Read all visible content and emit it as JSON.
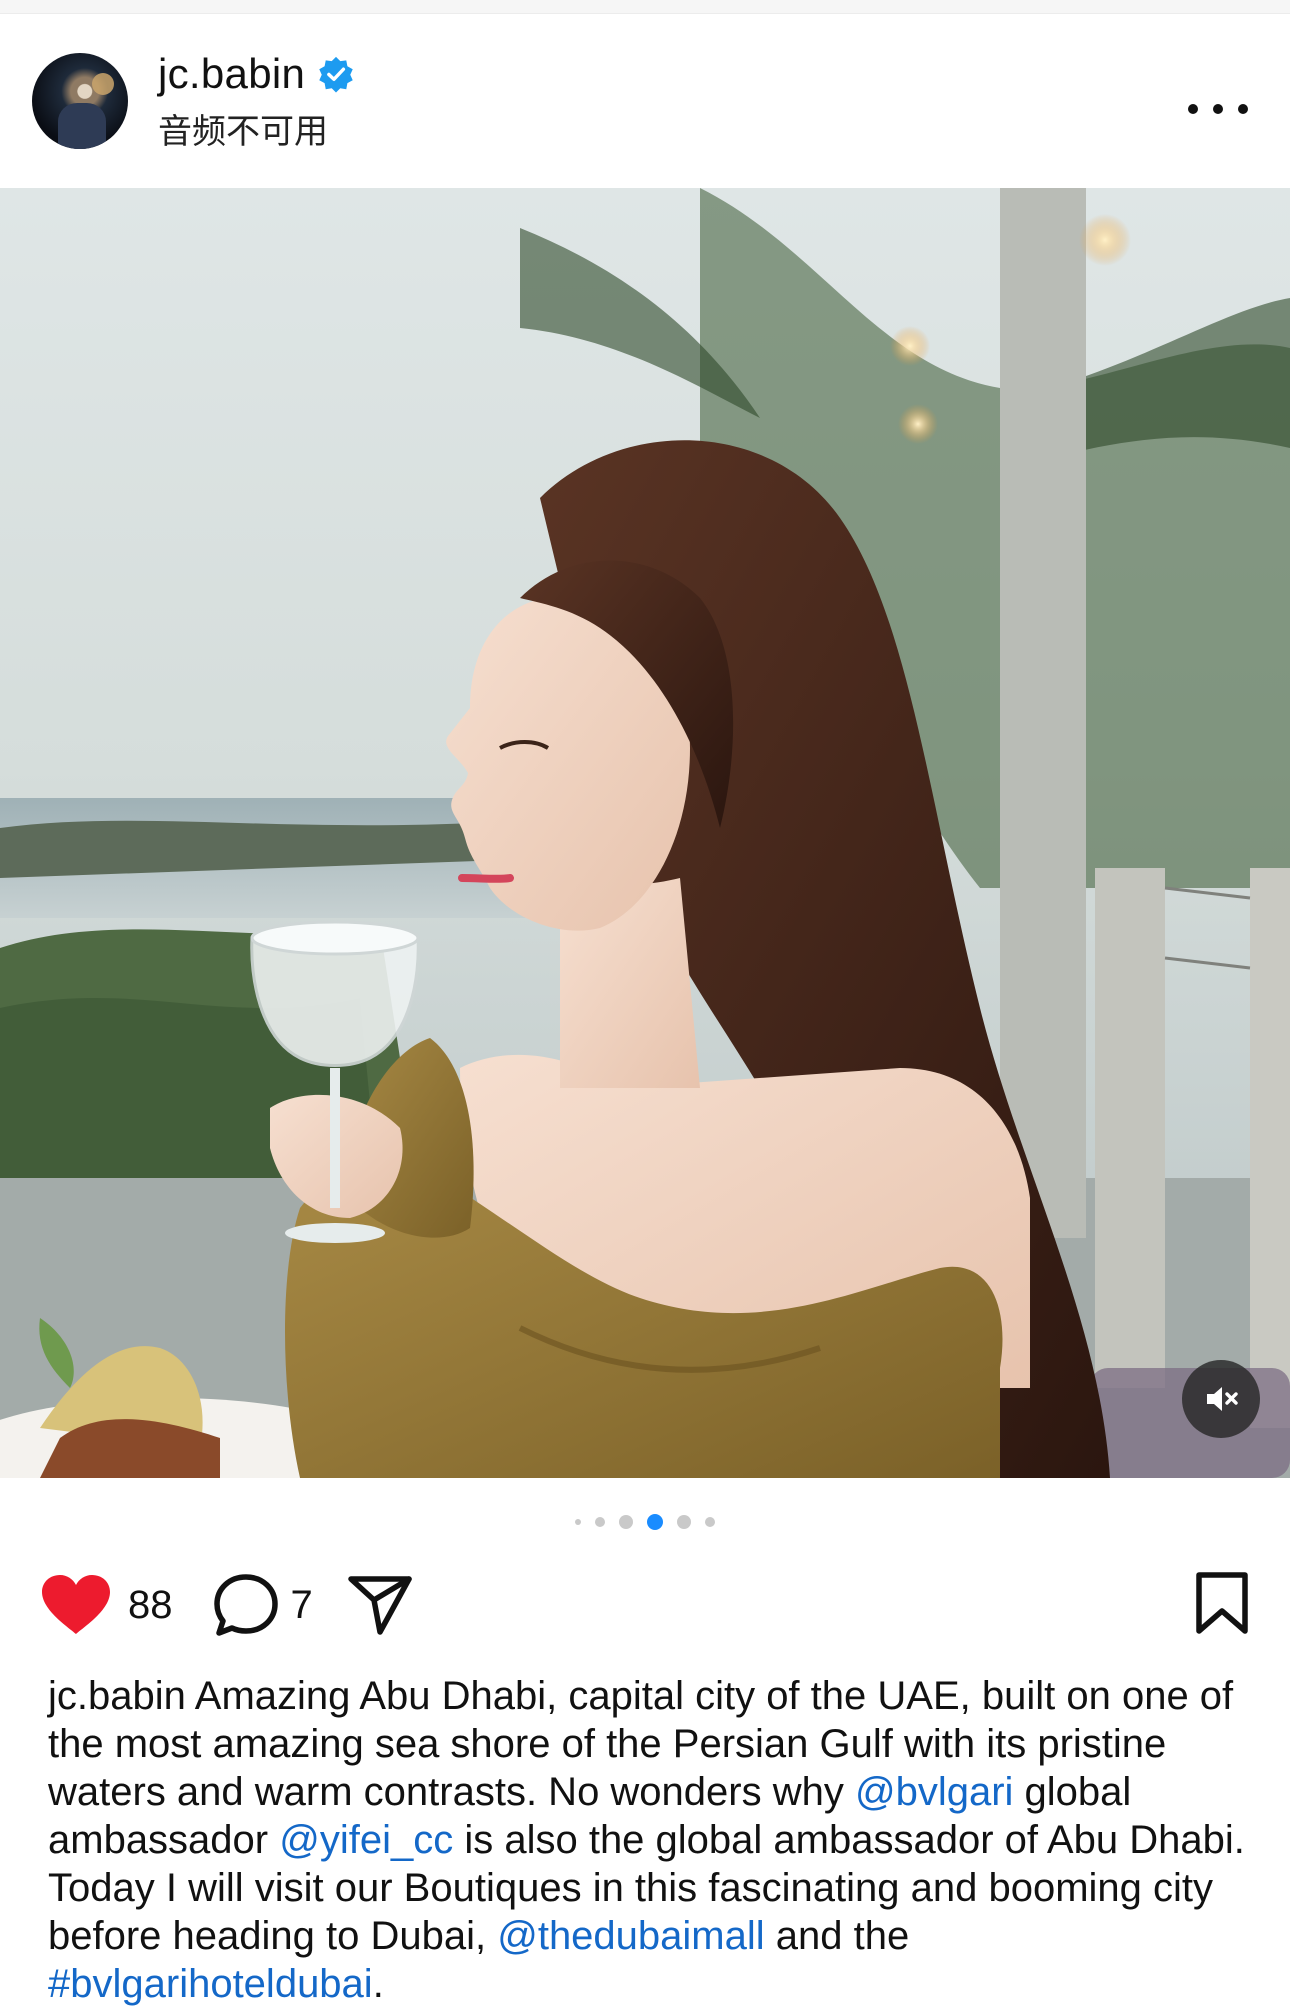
{
  "header": {
    "username": "jc.babin",
    "subtitle": "音频不可用",
    "icons": {
      "verified": "verified-badge-icon",
      "more": "more-options-icon"
    }
  },
  "media": {
    "icons": {
      "mute": "muted-speaker-icon"
    },
    "carousel": {
      "total": 6,
      "active_index": 3
    }
  },
  "actions": {
    "likes": "88",
    "comments": "7",
    "icons": {
      "like": "heart-filled-icon",
      "comment": "comment-bubble-icon",
      "share": "send-icon",
      "save": "bookmark-icon"
    },
    "colors": {
      "like": "#ed1b2e"
    }
  },
  "caption": {
    "user": "jc.babin",
    "segments": [
      {
        "text": " Amazing Abu Dhabi, capital city of the UAE, built on one of the most amazing sea shore of the Persian Gulf with its pristine waters and warm contrasts. No wonders why ",
        "link": false
      },
      {
        "text": "@bvlgari",
        "link": true
      },
      {
        "text": " global ambassador ",
        "link": false
      },
      {
        "text": "@yifei_cc",
        "link": true
      },
      {
        "text": " is also the global ambassador of Abu Dhabi. Today I will visit our Boutiques in this fascinating and booming city before heading to Dubai, ",
        "link": false
      },
      {
        "text": "@thedubaimall",
        "link": true
      },
      {
        "text": " and the ",
        "link": false
      },
      {
        "text": "#bvlgarihoteldubai",
        "link": true
      },
      {
        "text": ".",
        "link": false
      }
    ]
  },
  "colors": {
    "link": "#1468c8",
    "verified": "#1d9bf0",
    "active_dot": "#1a8cff"
  }
}
